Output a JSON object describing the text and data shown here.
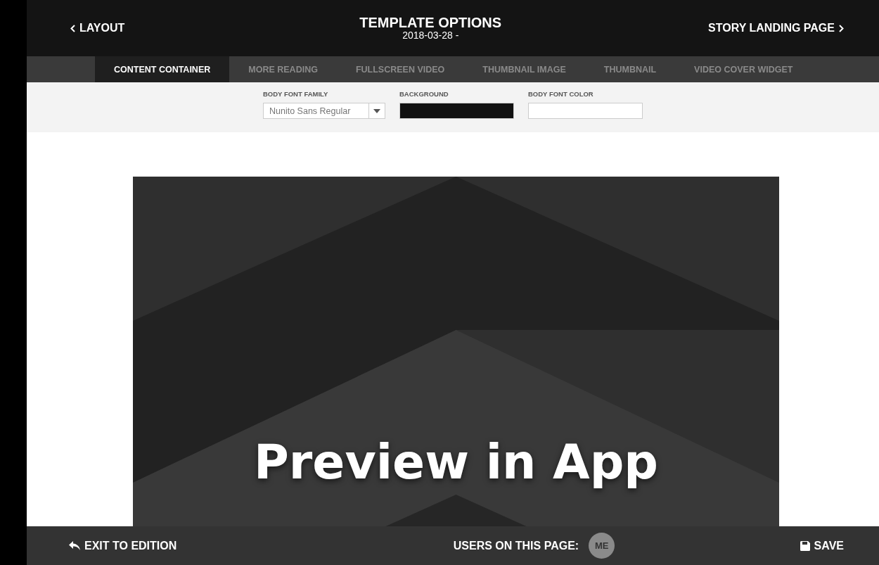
{
  "header": {
    "back": "LAYOUT",
    "title": "TEMPLATE OPTIONS",
    "subtitle": "2018-03-28 -",
    "next": "STORY LANDING PAGE"
  },
  "tabs": [
    {
      "label": "CONTENT CONTAINER",
      "selected": true
    },
    {
      "label": "MORE READING",
      "selected": false
    },
    {
      "label": "FULLSCREEN VIDEO",
      "selected": false
    },
    {
      "label": "THUMBNAIL IMAGE",
      "selected": false
    },
    {
      "label": "THUMBNAIL",
      "selected": false
    },
    {
      "label": "VIDEO COVER WIDGET",
      "selected": false
    }
  ],
  "options": [
    {
      "kind": "select",
      "label": "BODY FONT FAMILY",
      "value": "Nunito Sans Regular"
    },
    {
      "kind": "color",
      "label": "BACKGROUND",
      "color": "#111111"
    },
    {
      "kind": "color",
      "label": "BODY FONT COLOR",
      "color": "#ffffff"
    }
  ],
  "preview": {
    "text": "Preview in App"
  },
  "footer": {
    "exit": "EXIT TO EDITION",
    "users_label": "USERS ON THIS PAGE:",
    "user": "ME",
    "save": "SAVE"
  }
}
